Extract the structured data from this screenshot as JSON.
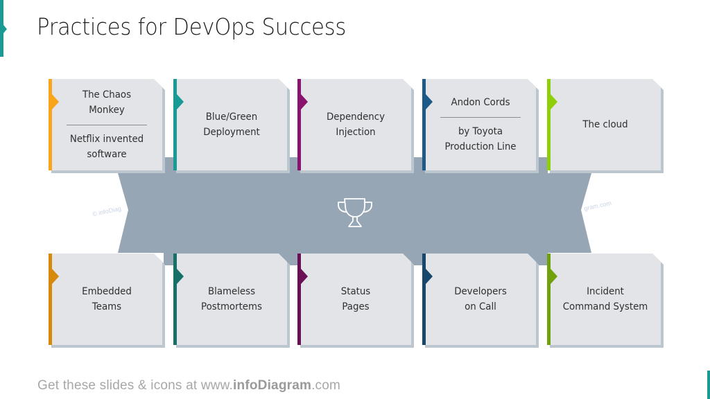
{
  "slide": {
    "title": "Practices for DevOps Success",
    "accent_color": "#1a9a94",
    "footer": {
      "prefix": "Get these slides & icons at www.",
      "brand": "infoDiagram",
      "suffix": ".com"
    },
    "watermark_left": "© infoDiag",
    "watermark_right": "gram.com"
  },
  "center": {
    "icon": "trophy-icon",
    "ribbon_color": "#97a6b4"
  },
  "colors": {
    "card_fill": "#e2e4e8",
    "card_shadow": "#bcc6ce"
  },
  "top_row": [
    {
      "title": "The Chaos Monkey",
      "lines": [
        "The Chaos",
        "Monkey"
      ],
      "subtitle_lines": [
        "Netflix invented",
        "software"
      ],
      "accent": "#f9a51c"
    },
    {
      "title": "Blue/Green Deployment",
      "lines": [
        "Blue/Green",
        "Deployment"
      ],
      "subtitle_lines": [],
      "accent": "#1a9a94"
    },
    {
      "title": "Dependency Injection",
      "lines": [
        "Dependency",
        "Injection"
      ],
      "subtitle_lines": [],
      "accent": "#8a1370"
    },
    {
      "title": "Andon Cords",
      "lines": [
        "Andon Cords"
      ],
      "subtitle_lines": [
        "by Toyota",
        "Production Line"
      ],
      "accent": "#1d5a87"
    },
    {
      "title": "The cloud",
      "lines": [
        "The cloud"
      ],
      "subtitle_lines": [],
      "accent": "#8fcf0a"
    }
  ],
  "bottom_row": [
    {
      "title": "Embedded Teams",
      "lines": [
        "Embedded",
        "Teams"
      ],
      "accent": "#d6890b"
    },
    {
      "title": "Blameless Postmortems",
      "lines": [
        "Blameless",
        "Postmortems"
      ],
      "accent": "#177068"
    },
    {
      "title": "Status Pages",
      "lines": [
        "Status",
        "Pages"
      ],
      "accent": "#6a0e55"
    },
    {
      "title": "Developers on Call",
      "lines": [
        "Developers",
        "on Call"
      ],
      "accent": "#17476b"
    },
    {
      "title": "Incident Command System",
      "lines": [
        "Incident",
        "Command System"
      ],
      "accent": "#70a00c"
    }
  ]
}
